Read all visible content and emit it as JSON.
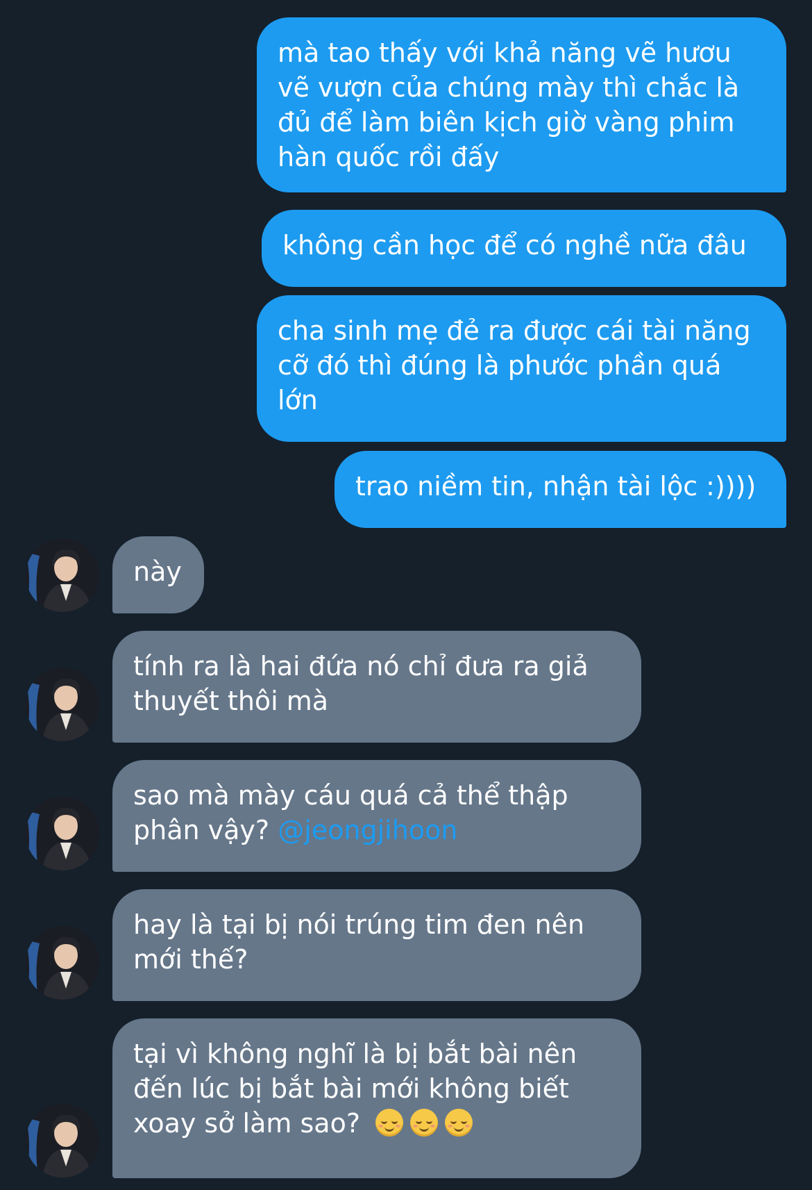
{
  "conversation": {
    "sent": [
      {
        "text": "mà tao thấy với khả năng vẽ hươu vẽ vượn của chúng mày thì chắc là đủ để làm biên kịch giờ vàng phim hàn quốc rồi đấy"
      },
      {
        "text": "không cần học để có nghề nữa đâu"
      },
      {
        "text": "cha sinh mẹ đẻ ra được cái tài năng cỡ đó thì đúng là phước phần quá lớn"
      },
      {
        "text": "trao niềm tin, nhận tài lộc :))))"
      }
    ],
    "received": [
      {
        "text": "này"
      },
      {
        "text": "tính ra là hai đứa nó chỉ đưa ra giả thuyết thôi mà"
      },
      {
        "text": "sao mà mày cáu quá cả thể thập phân vậy?",
        "mention": "@jeongjihoon"
      },
      {
        "text": "hay là tại bị nói trúng tim đen nên mới thế?"
      },
      {
        "text": "tại vì không nghĩ là bị bắt bài nên đến lúc bị bắt bài mới không biết xoay sở làm sao?",
        "emoji": [
          "relieved-face-emoji",
          "relieved-face-emoji",
          "relieved-face-emoji"
        ]
      }
    ]
  },
  "colors": {
    "background": "#15202b",
    "sent_bubble": "#1d9bf0",
    "received_bubble": "#66778a",
    "mention": "#1d9bf0",
    "text": "#ffffff"
  },
  "avatar": {
    "icon": "user-avatar-photo"
  }
}
